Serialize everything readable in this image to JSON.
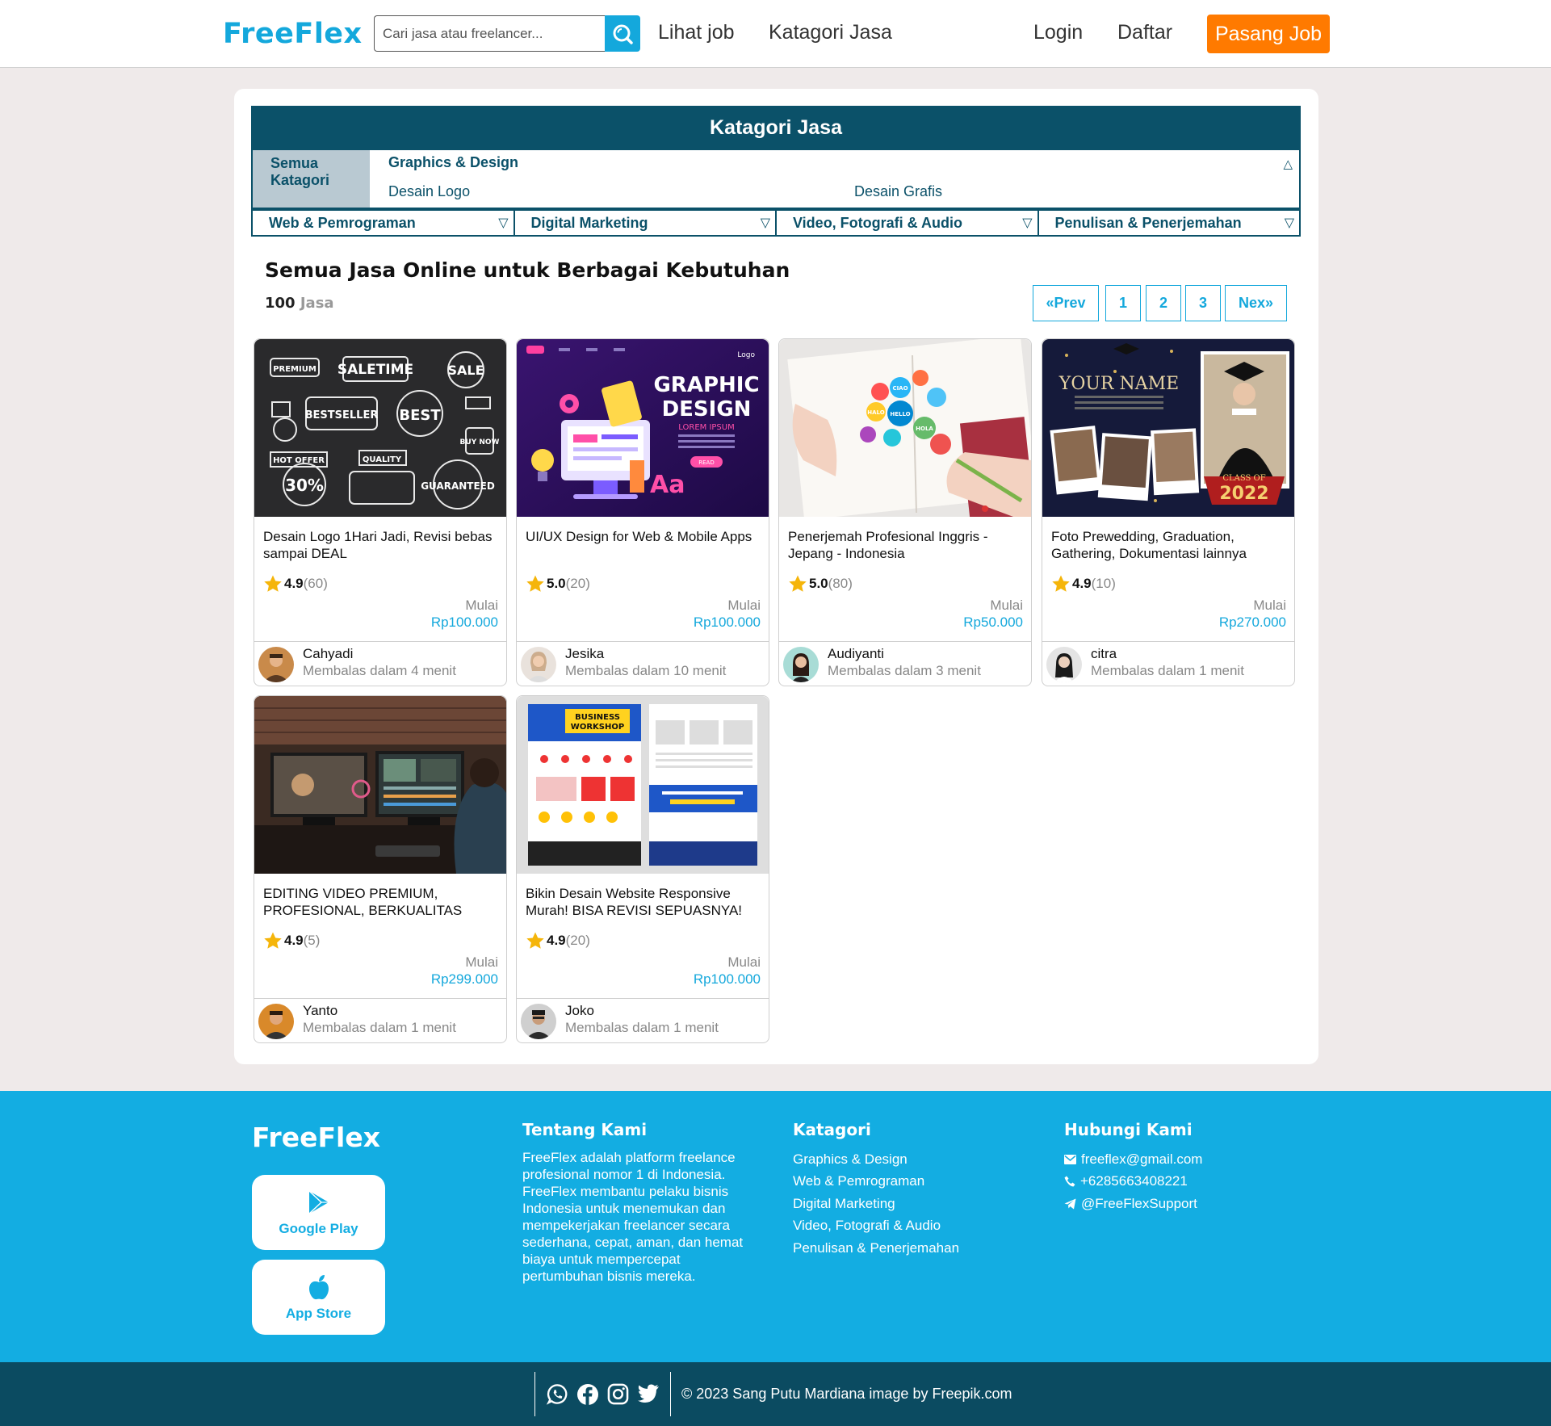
{
  "brand": "FreeFlex",
  "nav": {
    "search_placeholder": "Cari jasa atau freelancer...",
    "lihat_job": "Lihat job",
    "kategori": "Katagori Jasa",
    "login": "Login",
    "daftar": "Daftar",
    "pasang_job": "Pasang Job"
  },
  "categories": {
    "header": "Katagori Jasa",
    "all": "Semua Katagori",
    "open": {
      "title": "Graphics & Design",
      "items": [
        "Desain Logo",
        "Desain Grafis"
      ]
    },
    "row": [
      "Web & Pemrograman",
      "Digital Marketing",
      "Video, Fotografi & Audio",
      "Penulisan & Penerjemahan"
    ]
  },
  "listing": {
    "title": "Semua Jasa Online untuk Berbagai Kebutuhan",
    "count": "100",
    "count_unit": "Jasa",
    "pagination": [
      "«Prev",
      "1",
      "2",
      "3",
      "Nex»"
    ]
  },
  "products": [
    {
      "title": "Desain Logo 1Hari Jadi, Revisi bebas sampai DEAL",
      "rating": "4.9",
      "reviews": "(60)",
      "mulai": "Mulai",
      "price": "Rp100.000",
      "seller": "Cahyadi",
      "reply": "Membalas dalam 4 menit"
    },
    {
      "title": "UI/UX Design for Web & Mobile Apps",
      "rating": "5.0",
      "reviews": "(20)",
      "mulai": "Mulai",
      "price": "Rp100.000",
      "seller": "Jesika",
      "reply": "Membalas dalam 10 menit"
    },
    {
      "title": "Penerjemah Profesional Inggris - Jepang - Indonesia",
      "rating": "5.0",
      "reviews": "(80)",
      "mulai": "Mulai",
      "price": "Rp50.000",
      "seller": "Audiyanti",
      "reply": "Membalas dalam 3 menit"
    },
    {
      "title": "Foto Prewedding, Graduation, Gathering, Dokumentasi lainnya",
      "rating": "4.9",
      "reviews": "(10)",
      "mulai": "Mulai",
      "price": "Rp270.000",
      "seller": "citra",
      "reply": "Membalas dalam 1 menit"
    },
    {
      "title": "EDITING VIDEO PREMIUM, PROFESIONAL, BERKUALITAS",
      "rating": "4.9",
      "reviews": "(5)",
      "mulai": "Mulai",
      "price": "Rp299.000",
      "seller": "Yanto",
      "reply": "Membalas dalam 1 menit"
    },
    {
      "title": "Bikin Desain Website Responsive Murah! BISA REVISI SEPUASNYA!",
      "rating": "4.9",
      "reviews": "(20)",
      "mulai": "Mulai",
      "price": "Rp100.000",
      "seller": "Joko",
      "reply": "Membalas dalam 1 menit"
    }
  ],
  "thumb_text": {
    "p1": [
      "PREMIUM",
      "SALETIME",
      "SALE",
      "BESTSELLER",
      "BEST",
      "HOT OFFER",
      "30%",
      "QUALITY",
      "GUARANTEED",
      "BUY NOW"
    ],
    "p2": [
      "GRAPHIC",
      "DESIGN",
      "LOREM IPSUM",
      "Logo",
      "Aa",
      "READ"
    ],
    "p3": [
      "CIAO",
      "HELLO",
      "HALO",
      "HOLA"
    ],
    "p4": [
      "YOUR NAME",
      "CLASS OF",
      "2022"
    ],
    "p6": [
      "BUSINESS",
      "WORKSHOP"
    ]
  },
  "footer": {
    "brand": "FreeFlex",
    "google_play": "Google Play",
    "app_store": "App Store",
    "about_title": "Tentang Kami",
    "about_text": "FreeFlex adalah platform freelance profesional nomor 1 di Indonesia. FreeFlex membantu pelaku bisnis Indonesia untuk menemukan dan mempekerjakan freelancer secara sederhana, cepat, aman, dan hemat biaya untuk mempercepat pertumbuhan bisnis mereka.",
    "cat_title": "Katagori",
    "cat_items": [
      "Graphics & Design",
      "Web & Pemrograman",
      "Digital Marketing",
      "Video, Fotografi & Audio",
      "Penulisan & Penerjemahan"
    ],
    "contact_title": "Hubungi Kami",
    "email": "freeflex@gmail.com",
    "phone": "+6285663408221",
    "telegram": "@FreeFlexSupport",
    "copyright": "© 2023 Sang Putu Mardiana image by Freepik.com"
  },
  "colors": {
    "brand_blue": "#14a8dc",
    "dark_teal": "#0b5169",
    "orange": "#ff7a00",
    "star": "#f5b50a"
  },
  "icons": [
    "search-icon",
    "star-icon",
    "google-play-icon",
    "apple-icon",
    "mail-icon",
    "phone-icon",
    "telegram-icon",
    "whatsapp-icon",
    "facebook-icon",
    "instagram-icon",
    "twitter-icon"
  ]
}
